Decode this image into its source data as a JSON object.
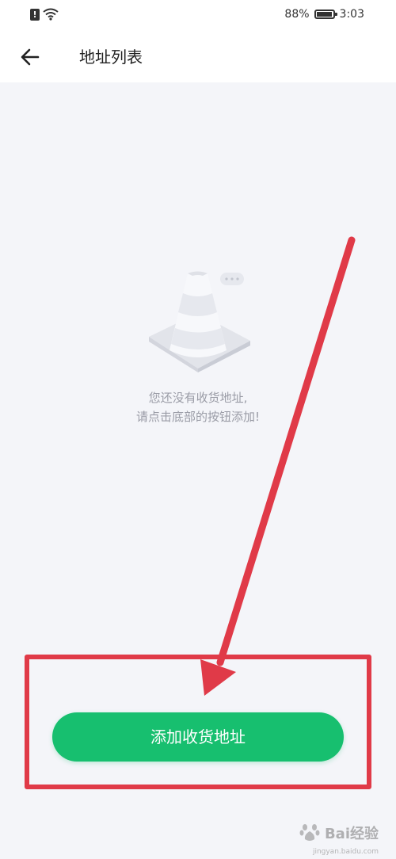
{
  "status_bar": {
    "battery": "88%",
    "time": "3:03",
    "icons": [
      "alert-icon",
      "wifi-icon",
      "battery-icon"
    ]
  },
  "header": {
    "back_icon": "back-arrow-icon",
    "title": "地址列表"
  },
  "empty_state": {
    "illustration": "traffic-cone-icon",
    "line1": "您还没有收货地址,",
    "line2": "请点击底部的按钮添加!"
  },
  "add_button": {
    "label": "添加收货地址",
    "color": "#17bf6f"
  },
  "annotation": {
    "color": "#e03a48"
  },
  "watermark": {
    "text": "Bai经验",
    "subtext": "jingyan.baidu.com"
  }
}
